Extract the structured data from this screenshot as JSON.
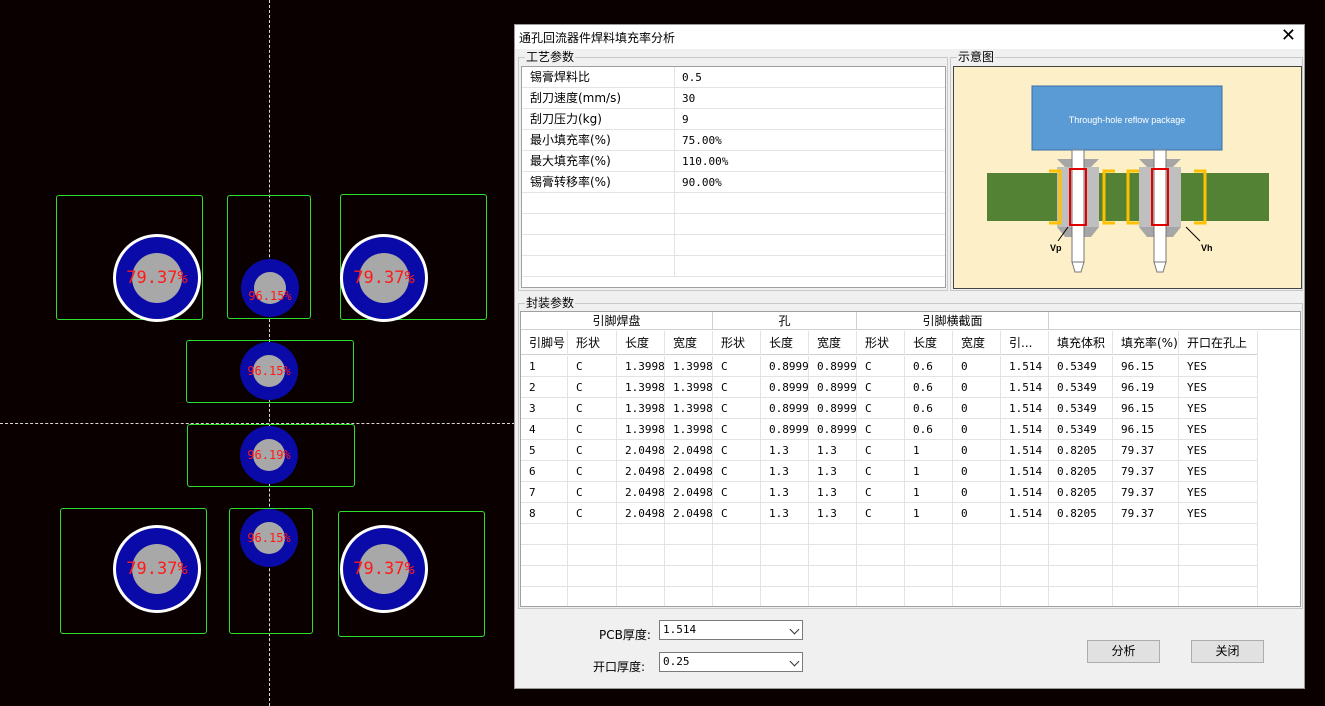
{
  "canvas": {
    "vias": [
      {
        "label": "79.37%"
      },
      {
        "label": "96.15%"
      },
      {
        "label": "79.37%"
      },
      {
        "label": "96.15%"
      },
      {
        "label": "96.19%"
      },
      {
        "label": "79.37%"
      },
      {
        "label": "96.15%"
      },
      {
        "label": "79.37%"
      }
    ]
  },
  "dialog": {
    "title": "通孔回流器件焊料填充率分析",
    "close_glyph": "✕",
    "params": {
      "label": "工艺参数",
      "rows": [
        {
          "key": "锡膏焊料比",
          "value": "0.5"
        },
        {
          "key": "刮刀速度(mm/s)",
          "value": "30"
        },
        {
          "key": "刮刀压力(kg)",
          "value": "9"
        },
        {
          "key": "最小填充率(%)",
          "value": "75.00%"
        },
        {
          "key": "最大填充率(%)",
          "value": "110.00%"
        },
        {
          "key": "锡膏转移率(%)",
          "value": "90.00%"
        }
      ]
    },
    "diagram": {
      "label": "示意图",
      "package_text": "Through-hole reflow package",
      "vp": "Vp",
      "vh": "Vh"
    },
    "package": {
      "label": "封装参数",
      "groups": [
        "引脚焊盘",
        "孔",
        "引脚横截面",
        ""
      ],
      "columns": [
        "引脚号",
        "形状",
        "长度",
        "宽度",
        "形状",
        "长度",
        "宽度",
        "形状",
        "长度",
        "宽度",
        "引...",
        "填充体积",
        "填充率(%)",
        "开口在孔上"
      ],
      "rows": [
        [
          "1",
          "C",
          "1.3998",
          "1.3998",
          "C",
          "0.8999",
          "0.8999",
          "C",
          "0.6",
          "0",
          "1.514",
          "0.5349",
          "96.15",
          "YES"
        ],
        [
          "2",
          "C",
          "1.3998",
          "1.3998",
          "C",
          "0.8999",
          "0.8999",
          "C",
          "0.6",
          "0",
          "1.514",
          "0.5349",
          "96.19",
          "YES"
        ],
        [
          "3",
          "C",
          "1.3998",
          "1.3998",
          "C",
          "0.8999",
          "0.8999",
          "C",
          "0.6",
          "0",
          "1.514",
          "0.5349",
          "96.15",
          "YES"
        ],
        [
          "4",
          "C",
          "1.3998",
          "1.3998",
          "C",
          "0.8999",
          "0.8999",
          "C",
          "0.6",
          "0",
          "1.514",
          "0.5349",
          "96.15",
          "YES"
        ],
        [
          "5",
          "C",
          "2.0498",
          "2.0498",
          "C",
          "1.3",
          "1.3",
          "C",
          "1",
          "0",
          "1.514",
          "0.8205",
          "79.37",
          "YES"
        ],
        [
          "6",
          "C",
          "2.0498",
          "2.0498",
          "C",
          "1.3",
          "1.3",
          "C",
          "1",
          "0",
          "1.514",
          "0.8205",
          "79.37",
          "YES"
        ],
        [
          "7",
          "C",
          "2.0498",
          "2.0498",
          "C",
          "1.3",
          "1.3",
          "C",
          "1",
          "0",
          "1.514",
          "0.8205",
          "79.37",
          "YES"
        ],
        [
          "8",
          "C",
          "2.0498",
          "2.0498",
          "C",
          "1.3",
          "1.3",
          "C",
          "1",
          "0",
          "1.514",
          "0.8205",
          "79.37",
          "YES"
        ]
      ]
    },
    "pcb_thickness": {
      "label": "PCB厚度:",
      "value": "1.514"
    },
    "opening_thickness": {
      "label": "开口厚度:",
      "value": "0.25"
    },
    "analyze_button": "分析",
    "close_button": "关闭"
  }
}
